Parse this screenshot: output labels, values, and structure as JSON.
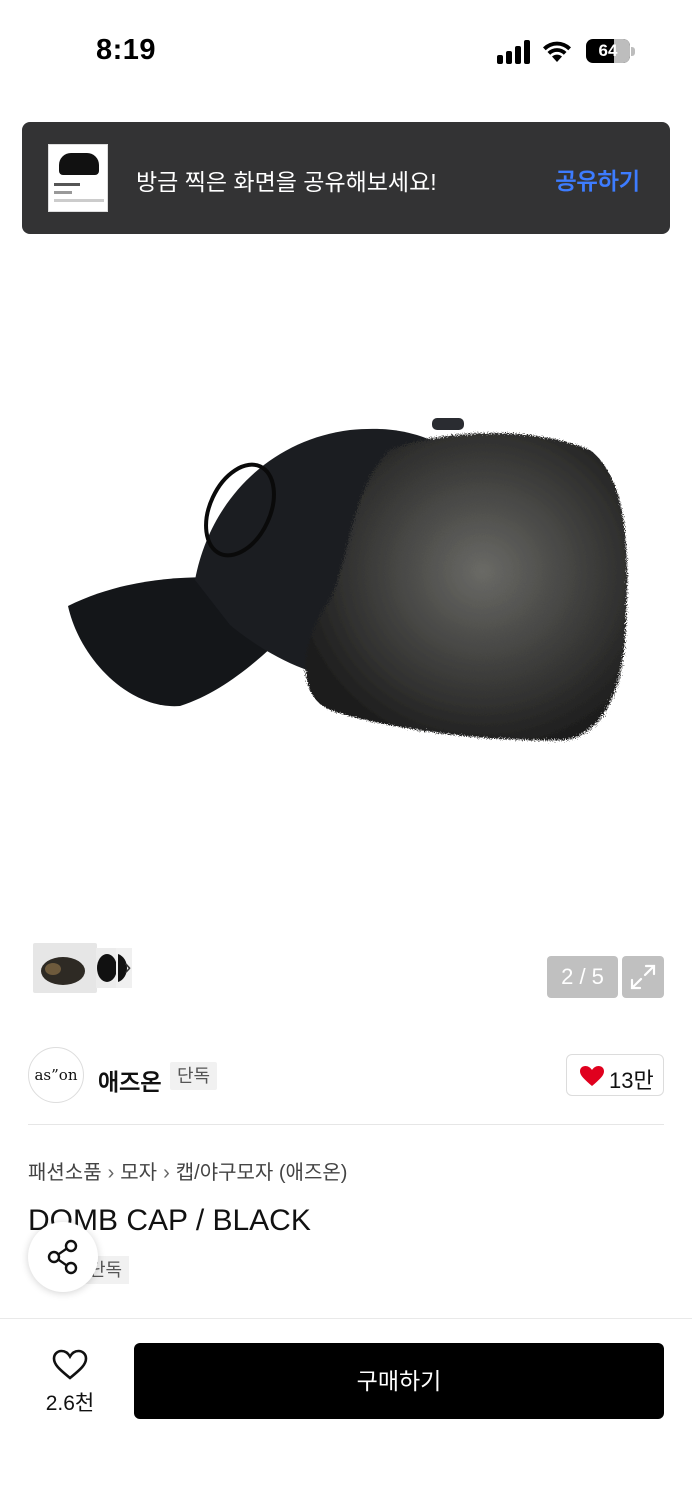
{
  "status_bar": {
    "time": "8:19",
    "battery": "64"
  },
  "share_banner": {
    "message": "방금 찍은 화면을 공유해보세요!",
    "action": "공유하기"
  },
  "gallery": {
    "page_counter": "2 / 5"
  },
  "brand": {
    "logo_text": "as”on",
    "name": "애즈온",
    "badge": "단독",
    "likes": "13만"
  },
  "breadcrumb": [
    "패션소품",
    "모자",
    "캡/야구모자 (애즈온)"
  ],
  "product": {
    "title": "DOMB CAP / BLACK",
    "tag": "단독"
  },
  "bottom_bar": {
    "wish_count": "2.6천",
    "buy_label": "구매하기"
  },
  "colors": {
    "accent": "#3d7cff",
    "like_heart": "#e0001e",
    "buy_button": "#000000",
    "banner_bg": "#333334"
  },
  "icons": [
    "signal-icon",
    "wifi-icon",
    "battery-icon",
    "chevron-right-icon",
    "expand-icon",
    "heart-icon",
    "share-icon",
    "heart-outline-icon"
  ]
}
